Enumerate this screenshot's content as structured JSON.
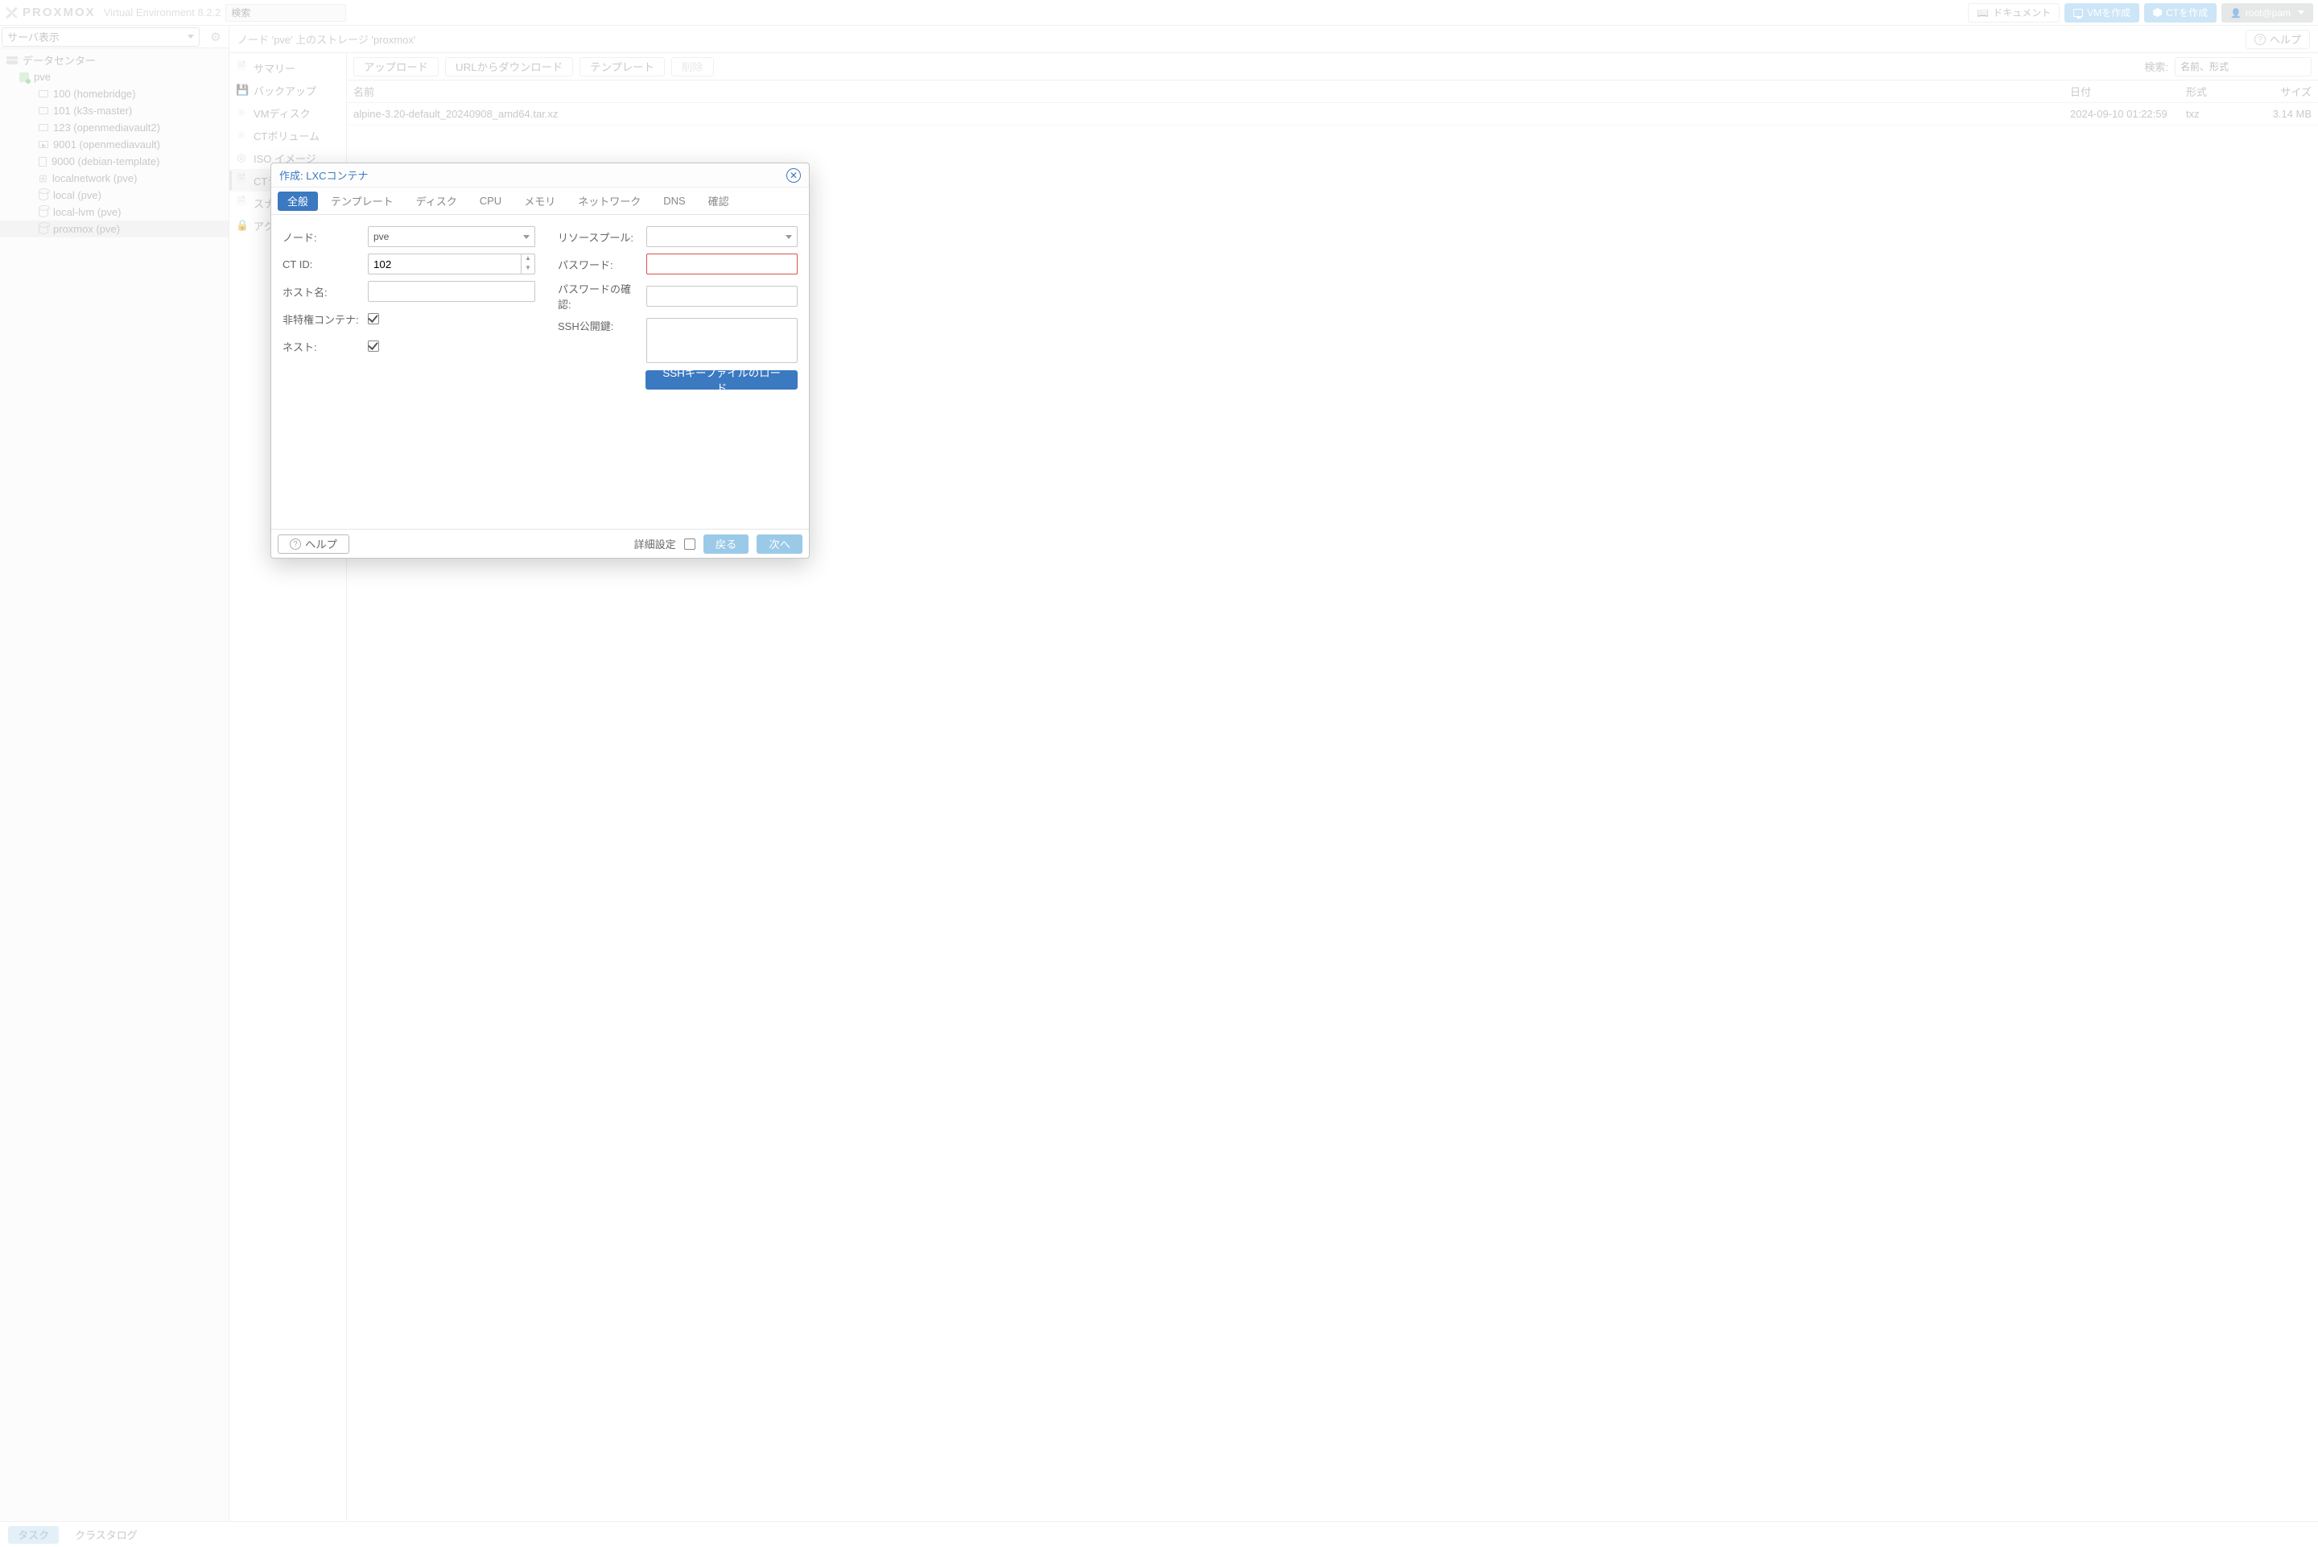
{
  "header": {
    "brand": "PROXMOX",
    "product": "Virtual Environment 8.2.2",
    "search_placeholder": "検索",
    "docs": "ドキュメント",
    "create_vm": "VMを作成",
    "create_ct": "CTを作成",
    "user": "root@pam"
  },
  "left": {
    "view_label": "サーバ表示",
    "tree": {
      "datacenter": "データセンター",
      "node": "pve",
      "items": [
        "100 (homebridge)",
        "101 (k3s-master)",
        "123 (openmediavault2)",
        "9001 (openmediavault)",
        "9000 (debian-template)",
        "localnetwork (pve)",
        "local (pve)",
        "local-lvm (pve)",
        "proxmox (pve)"
      ]
    }
  },
  "main": {
    "title": "ノード 'pve' 上のストレージ 'proxmox'",
    "help": "ヘルプ",
    "centernav": [
      "サマリー",
      "バックアップ",
      "VMディスク",
      "CTボリューム",
      "ISO イメージ",
      "CTテンプレート",
      "スナップショット",
      "アクセス権限"
    ],
    "toolbar": {
      "upload": "アップロード",
      "download": "URLからダウンロード",
      "templates": "テンプレート",
      "delete": "削除",
      "search_label": "検索:",
      "search_placeholder": "名前、形式"
    },
    "grid": {
      "cols": {
        "name": "名前",
        "date": "日付",
        "fmt": "形式",
        "size": "サイズ"
      },
      "rows": [
        {
          "name": "alpine-3.20-default_20240908_amd64.tar.xz",
          "date": "2024-09-10 01:22:59",
          "fmt": "txz",
          "size": "3.14 MB"
        }
      ]
    }
  },
  "taskbar": {
    "tasks": "タスク",
    "cluster_log": "クラスタログ"
  },
  "modal": {
    "title": "作成: LXCコンテナ",
    "tabs": [
      "全般",
      "テンプレート",
      "ディスク",
      "CPU",
      "メモリ",
      "ネットワーク",
      "DNS",
      "確認"
    ],
    "left": {
      "node_label": "ノード:",
      "node_value": "pve",
      "ctid_label": "CT ID:",
      "ctid_value": "102",
      "host_label": "ホスト名:",
      "unpriv_label": "非特権コンテナ:",
      "nest_label": "ネスト:"
    },
    "right": {
      "pool_label": "リソースプール:",
      "pw_label": "パスワード:",
      "pw2_label": "パスワードの確認:",
      "ssh_label": "SSH公開鍵:",
      "ssh_btn": "SSHキーファイルのロード"
    },
    "foot": {
      "help": "ヘルプ",
      "adv": "詳細設定",
      "back": "戻る",
      "next": "次へ"
    }
  }
}
